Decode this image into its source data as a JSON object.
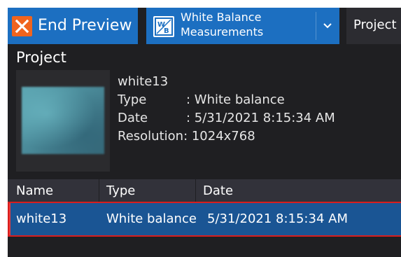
{
  "toolbar": {
    "end_preview_label": "End Preview",
    "end_preview_icon": "close-icon",
    "mode_select": {
      "line1": "White Balance",
      "line2": "Measurements",
      "icon": "white-balance-icon",
      "icon_text": "WB"
    },
    "project_tab_label": "Project"
  },
  "panel": {
    "title": "Project",
    "item_name": "white13",
    "type_key": "Type",
    "type_value": ": White balance",
    "date_key": "Date",
    "date_value": ": 5/31/2021 8:15:34 AM",
    "resolution_key": "Resolution",
    "resolution_value": ": 1024x768"
  },
  "table": {
    "headers": [
      "Name",
      "Type",
      "Date"
    ],
    "rows": [
      [
        "white13",
        "White balance",
        "5/31/2021 8:15:34 AM"
      ]
    ]
  },
  "colors": {
    "accent_blue": "#1c6fc1",
    "close_orange": "#f0641e",
    "background": "#1f1f22",
    "selected_row": "#1a5594",
    "highlight_red": "#d81e1e"
  }
}
